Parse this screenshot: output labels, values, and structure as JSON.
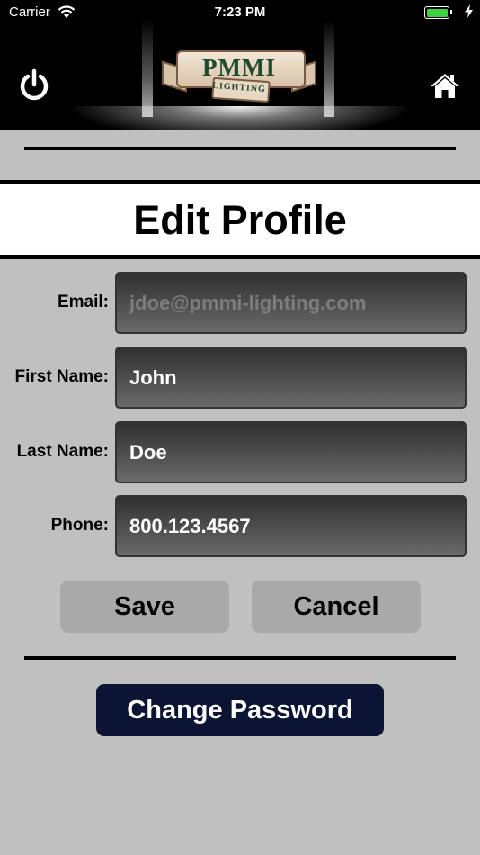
{
  "status_bar": {
    "carrier": "Carrier",
    "time": "7:23 PM",
    "battery_color": "#3ed143"
  },
  "header": {
    "logo_brand": "PMMI",
    "logo_sub": "LIGHTING",
    "power_icon": "power-icon",
    "home_icon": "home-icon"
  },
  "page": {
    "title": "Edit Profile"
  },
  "form": {
    "email": {
      "label": "Email:",
      "value": "jdoe@pmmi-lighting.com"
    },
    "first_name": {
      "label": "First Name:",
      "value": "John"
    },
    "last_name": {
      "label": "Last Name:",
      "value": "Doe"
    },
    "phone": {
      "label": "Phone:",
      "value": "800.123.4567"
    }
  },
  "actions": {
    "save_label": "Save",
    "cancel_label": "Cancel",
    "change_password_label": "Change Password"
  },
  "colors": {
    "background": "#c0c0c0",
    "header_bg": "#000000",
    "button_gray": "#a9a9a9",
    "button_navy": "#0b1533"
  }
}
